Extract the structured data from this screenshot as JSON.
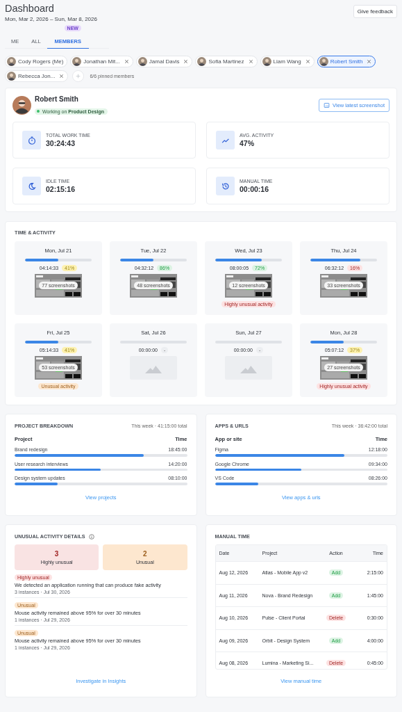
{
  "header": {
    "title": "Dashboard",
    "date_range": "Mon, Mar 2, 2026 – Sun, Mar 8, 2026",
    "feedback_button": "Give feedback"
  },
  "tabs": [
    {
      "label": "ME",
      "selected": false
    },
    {
      "label": "ALL",
      "selected": false
    },
    {
      "label": "MEMBERS",
      "selected": true,
      "badge": "NEW"
    }
  ],
  "members": [
    {
      "name": "Cody Rogers (Me)",
      "selected": false,
      "removable": false
    },
    {
      "name": "Jonathan Mit...",
      "selected": false,
      "removable": true
    },
    {
      "name": "Jamal Davis",
      "selected": false,
      "removable": true
    },
    {
      "name": "Sofia Martinez",
      "selected": false,
      "removable": true
    },
    {
      "name": "Liam Wang",
      "selected": false,
      "removable": true
    },
    {
      "name": "Robert Smith",
      "selected": true,
      "removable": true
    },
    {
      "name": "Rebecca Jon...",
      "selected": false,
      "removable": true
    }
  ],
  "pinned_count": "6/6 pinned members",
  "profile": {
    "name": "Robert Smith",
    "status": "Working on **Product Design**",
    "screenshot_button": "View latest screenshot"
  },
  "stats": [
    {
      "kind": "stopwatch",
      "label": "TOTAL WORK TIME",
      "value": "30:24:43"
    },
    {
      "kind": "trend",
      "label": "AVG. ACTIVITY",
      "value": "47%"
    },
    {
      "kind": "moon",
      "label": "IDLE TIME",
      "value": "02:15:16"
    },
    {
      "kind": "history",
      "label": "MANUAL TIME",
      "value": "00:00:16"
    }
  ],
  "time_activity": {
    "title": "TIME & ACTIVITY",
    "days": [
      {
        "date": "Mon, Jul 21",
        "level": 0.5,
        "duration": "04:14:33",
        "activity": {
          "text": "41%",
          "color": "#fdf1b0"
        },
        "screenshots": "77 screenshots"
      },
      {
        "date": "Tue, Jul 22",
        "level": 0.5,
        "duration": "04:32:12",
        "activity": {
          "text": "86%",
          "color": "#dcf3e3"
        },
        "screenshots": "48 screenshots"
      },
      {
        "date": "Wed, Jul 23",
        "level": 0.7,
        "duration": "08:00:05",
        "activity": {
          "text": "72%",
          "color": "#dcf3e3"
        },
        "screenshots": "12 screenshots",
        "flag": {
          "text": "Highly unusual activity",
          "color": "#fde2e2"
        }
      },
      {
        "date": "Thu, Jul 24",
        "level": 0.75,
        "duration": "06:32:12",
        "activity": {
          "text": "16%",
          "color": "#fde2e2"
        },
        "screenshots": "33 screenshots"
      },
      {
        "date": "Fri, Jul 25",
        "level": 0.5,
        "duration": "05:14:33",
        "activity": {
          "text": "41%",
          "color": "#fdf1b0"
        },
        "screenshots": "53 screenshots",
        "flag": {
          "text": "Unusual activity",
          "color": "#fde7cf"
        }
      },
      {
        "date": "Sat, Jul 26",
        "duration": "00:00:00",
        "activity": {
          "text": "-",
          "color": "#eceef1"
        }
      },
      {
        "date": "Sun, Jul 27",
        "duration": "00:00:00",
        "activity": {
          "text": "-",
          "color": "#eceef1"
        }
      },
      {
        "date": "Mon, Jul 28",
        "level": 0.5,
        "duration": "05:07:12",
        "activity": {
          "text": "37%",
          "color": "#fdf1b0"
        },
        "screenshots": "27 screenshots",
        "flag": {
          "text": "Highly unusual activity",
          "color": "#fde2e2"
        }
      }
    ]
  },
  "breakdowns": [
    {
      "title": "PROJECT BREAKDOWN",
      "summary": "This week · 41:15:00 total",
      "columns": [
        "Project",
        "Time"
      ],
      "rows": [
        {
          "name": "Brand redesign",
          "time": "18:45:00",
          "level": 0.75
        },
        {
          "name": "User research interviews",
          "time": "14:20:00",
          "level": 0.5
        },
        {
          "name": "Design system updates",
          "time": "08:10:00",
          "level": 0.25
        }
      ],
      "link": "View projects"
    },
    {
      "title": "APPS & URLS",
      "summary": "This week · 36:42:00 total",
      "columns": [
        "App or site",
        "Time"
      ],
      "rows": [
        {
          "name": "Figma",
          "time": "12:18:00",
          "level": 0.75
        },
        {
          "name": "Google Chrome",
          "time": "09:34:00",
          "level": 0.5
        },
        {
          "name": "VS Code",
          "time": "08:26:00",
          "level": 0.25
        }
      ],
      "link": "View apps & urls"
    }
  ],
  "unusual": {
    "title": "UNUSUAL ACTIVITY DETAILS",
    "counts": [
      {
        "count": "3",
        "label": "Highly unusual",
        "color": "#f9e3e3"
      },
      {
        "count": "2",
        "label": "Unusual",
        "color": "#fde7cf"
      }
    ],
    "items": [
      {
        "tag": "Highly unusual",
        "color": "#fde2e2",
        "text": "We detected an application running that can produce fake activity",
        "meta": "3 instances · Jul 30, 2026"
      },
      {
        "tag": "Unusual",
        "color": "#fde7cf",
        "text": "Mouse activity remained above 95% for over 30 minutes",
        "meta": "1 instances · Jul 29, 2026"
      },
      {
        "tag": "Unusual",
        "color": "#fde7cf",
        "text": "Mouse activity remained above 95% for over 30 minutes",
        "meta": "1 instances · Jul 29, 2026"
      }
    ],
    "link": "Investigate in Insights"
  },
  "manual_time": {
    "title": "MANUAL TIME",
    "columns": [
      "Date",
      "Project",
      "Action",
      "Time"
    ],
    "rows": [
      {
        "date": "Aug 12, 2026",
        "project": "Atlas - Mobile App v2",
        "action": "Add",
        "color": "#dcf3e3",
        "time": "2:15:00"
      },
      {
        "date": "Aug 11, 2026",
        "project": "Nova - Brand Redesign",
        "action": "Add",
        "color": "#dcf3e3",
        "time": "1:45:00"
      },
      {
        "date": "Aug 10, 2026",
        "project": "Pulse - Client Portal",
        "action": "Delete",
        "color": "#fde2e2",
        "time": "0:30:00"
      },
      {
        "date": "Aug 09, 2026",
        "project": "Orbit - Design System",
        "action": "Add",
        "color": "#dcf3e3",
        "time": "4:00:00"
      },
      {
        "date": "Aug 08, 2026",
        "project": "Lumina - Marketing Si...",
        "action": "Delete",
        "color": "#fde2e2",
        "time": "0:45:00"
      }
    ],
    "link": "View manual time"
  }
}
